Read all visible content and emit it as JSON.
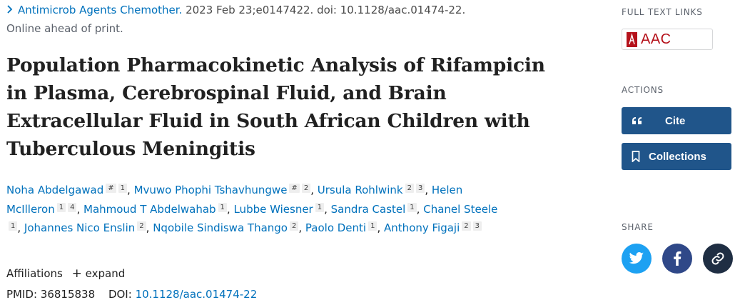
{
  "citation": {
    "journal": "Antimicrob Agents Chemother.",
    "details": "2023 Feb 23;e0147422. doi: 10.1128/aac.01474-22.",
    "status": "Online ahead of print."
  },
  "title": "Population Pharmacokinetic Analysis of Rifampicin in Plasma, Cerebrospinal Fluid, and Brain Extracellular Fluid in South African Children with Tuberculous Meningitis",
  "authors": [
    {
      "name": "Noha Abdelgawad",
      "sups": [
        "#",
        "1"
      ]
    },
    {
      "name": "Mvuwo Phophi Tshavhungwe",
      "sups": [
        "#",
        "2"
      ]
    },
    {
      "name": "Ursula Rohlwink",
      "sups": [
        "2",
        "3"
      ]
    },
    {
      "name": "Helen McIlleron",
      "sups": [
        "1",
        "4"
      ]
    },
    {
      "name": "Mahmoud T Abdelwahab",
      "sups": [
        "1"
      ]
    },
    {
      "name": "Lubbe Wiesner",
      "sups": [
        "1"
      ]
    },
    {
      "name": "Sandra Castel",
      "sups": [
        "1"
      ]
    },
    {
      "name": "Chanel Steele",
      "sups": [
        "1"
      ]
    },
    {
      "name": "Johannes Nico Enslin",
      "sups": [
        "2"
      ]
    },
    {
      "name": "Nqobile Sindiswa Thango",
      "sups": [
        "2"
      ]
    },
    {
      "name": "Paolo Denti",
      "sups": [
        "1"
      ]
    },
    {
      "name": "Anthony Figaji",
      "sups": [
        "2",
        "3"
      ]
    }
  ],
  "affiliations": {
    "label": "Affiliations",
    "expand": "expand"
  },
  "ids": {
    "pmid_label": "PMID:",
    "pmid": "36815838",
    "doi_label": "DOI:",
    "doi": "10.1128/aac.01474-22"
  },
  "sidebar": {
    "full_text_label": "FULL TEXT LINKS",
    "aac_text": "AAC",
    "actions_label": "ACTIONS",
    "cite_label": "Cite",
    "collections_label": "Collections",
    "share_label": "SHARE"
  },
  "icons": {
    "chevron": "chevron-right-icon",
    "quote": "quote-icon",
    "bookmark": "bookmark-icon",
    "twitter": "twitter-icon",
    "facebook": "facebook-icon",
    "link": "link-icon"
  },
  "colors": {
    "link": "#0071bc",
    "button": "#20558a",
    "twitter": "#1da1f2",
    "facebook": "#2f4888",
    "permalink": "#1f2e43",
    "aac": "#b5121b"
  }
}
